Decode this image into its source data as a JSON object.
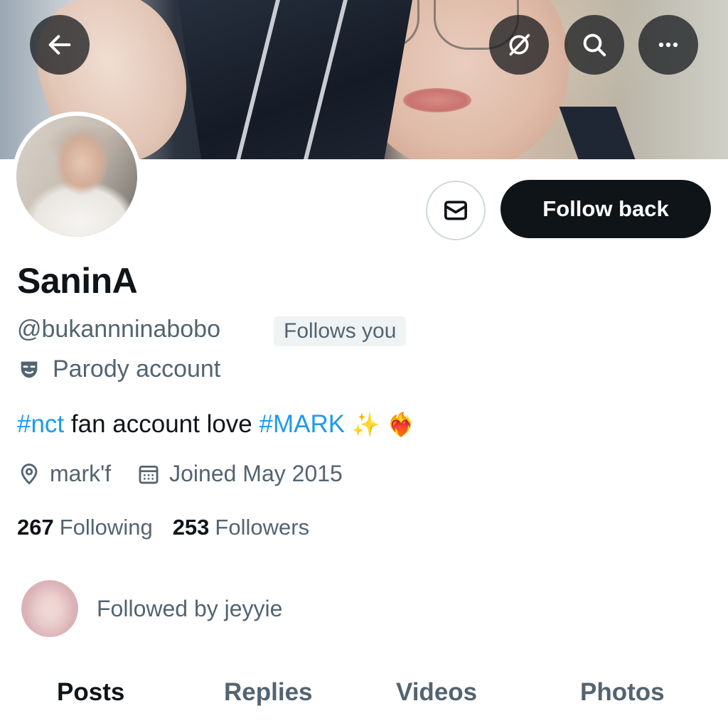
{
  "header": {
    "back_icon": "arrow-left-icon",
    "grok_icon": "grok-icon",
    "search_icon": "search-icon",
    "more_icon": "more-horizontal-icon"
  },
  "profile": {
    "name": "SaninA",
    "handle": "@bukannninabobo",
    "follows_you_badge": "Follows you",
    "parody_label": "Parody account",
    "bio": {
      "hashtag_1": "#nct",
      "text_1": " fan account love ",
      "hashtag_2": "#MARK",
      "emoji_sparkles": "✨",
      "emoji_heart": "❤️‍🔥"
    },
    "location": "mark'f",
    "joined": "Joined May 2015",
    "following_count": "267",
    "following_label": "Following",
    "followers_count": "253",
    "followers_label": "Followers",
    "followed_by": "Followed by jeyyie"
  },
  "actions": {
    "message_icon": "envelope-icon",
    "follow_back_label": "Follow back"
  },
  "tabs": [
    {
      "label": "Posts",
      "active": true
    },
    {
      "label": "Replies",
      "active": false
    },
    {
      "label": "Videos",
      "active": false
    },
    {
      "label": "Photos",
      "active": false
    }
  ],
  "colors": {
    "link_blue": "#1d9bf0",
    "primary_text": "#0f1419",
    "secondary_text": "#536471",
    "button_dark": "#0f1419"
  }
}
